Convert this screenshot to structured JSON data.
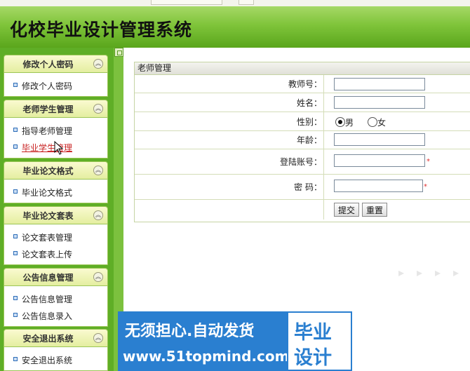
{
  "app": {
    "title": "化校毕业设计管理系统"
  },
  "sidebar": {
    "groups": [
      {
        "title": "修改个人密码",
        "items": [
          "修改个人密码"
        ]
      },
      {
        "title": "老师学生管理",
        "items": [
          "指导老师管理",
          "毕业学生管理"
        ],
        "active_item": "毕业学生管理"
      },
      {
        "title": "毕业论文格式",
        "items": [
          "毕业论文格式"
        ]
      },
      {
        "title": "毕业论文套表",
        "items": [
          "论文套表管理",
          "论文套表上传"
        ]
      },
      {
        "title": "公告信息管理",
        "items": [
          "公告信息管理",
          "公告信息录入"
        ]
      },
      {
        "title": "安全退出系统",
        "items": [
          "安全退出系统"
        ]
      }
    ]
  },
  "form": {
    "title": "老师管理",
    "fields": {
      "teacher_no": {
        "label": "教师号：",
        "value": ""
      },
      "name": {
        "label": "姓名：",
        "value": ""
      },
      "gender": {
        "label": "性别：",
        "options": [
          "男",
          "女"
        ],
        "selected": "男"
      },
      "age": {
        "label": "年龄：",
        "value": ""
      },
      "login_account": {
        "label": "登陆账号：",
        "value": "",
        "required_mark": "*"
      },
      "password": {
        "label": "密  码：",
        "value": "",
        "required_mark": "*"
      }
    },
    "buttons": {
      "submit": "提交",
      "reset": "重置"
    }
  },
  "watermark": {
    "slogan": "无须担心.自动发货",
    "url": "www.51topmind.com",
    "badge_line1": "毕业",
    "badge_line2": "设计"
  },
  "colors": {
    "header_green": "#7fc43a",
    "sidebar_green": "#5fae26",
    "active_link": "#c82020",
    "watermark_blue": "#2a7fd0"
  }
}
